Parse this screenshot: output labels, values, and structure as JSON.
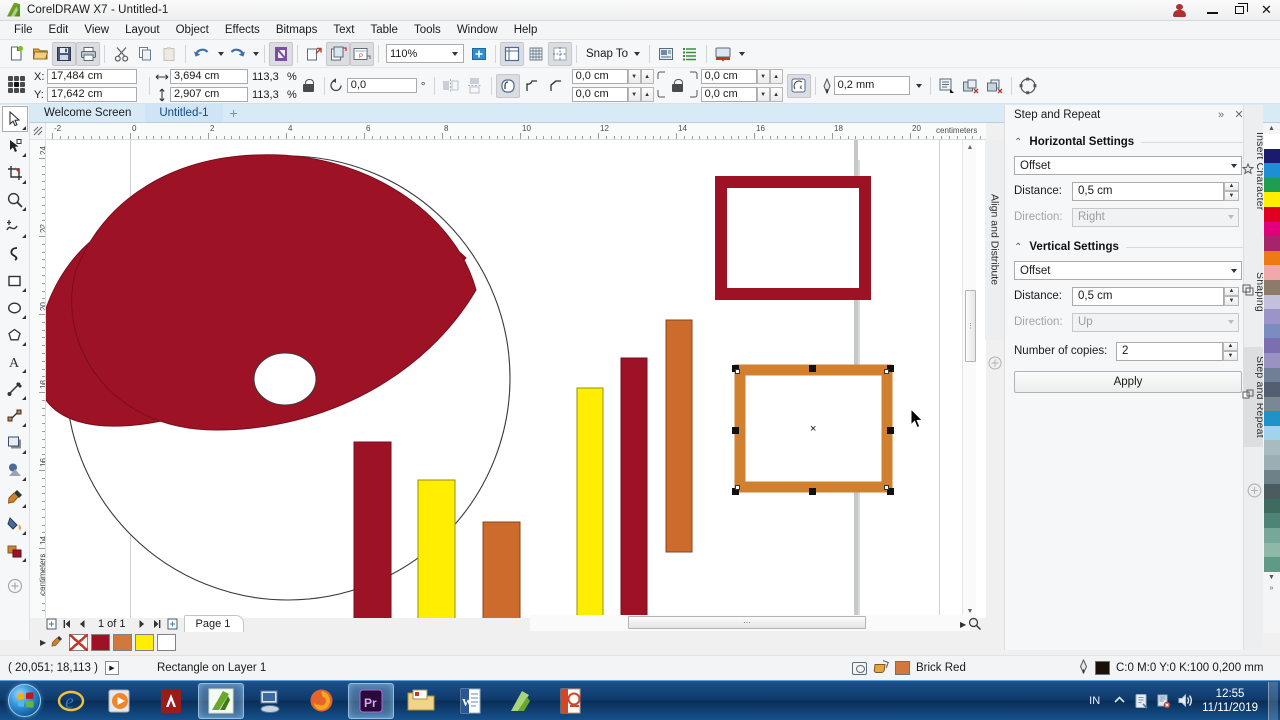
{
  "window": {
    "title": "CorelDRAW X7 - Untitled-1",
    "app_icon": "coreldraw-logo-icon",
    "user_icon": "user-account-icon",
    "minimize": "minimize-button",
    "maximize": "maximize-button",
    "close": "close-button"
  },
  "menubar": {
    "items": [
      {
        "label": "File"
      },
      {
        "label": "Edit"
      },
      {
        "label": "View"
      },
      {
        "label": "Layout"
      },
      {
        "label": "Object"
      },
      {
        "label": "Effects"
      },
      {
        "label": "Bitmaps"
      },
      {
        "label": "Text"
      },
      {
        "label": "Table"
      },
      {
        "label": "Tools"
      },
      {
        "label": "Window"
      },
      {
        "label": "Help"
      }
    ]
  },
  "toolbar": {
    "buttons": [
      {
        "name": "new-document-icon"
      },
      {
        "name": "open-document-icon"
      },
      {
        "name": "save-document-icon"
      },
      {
        "name": "print-icon"
      },
      {
        "name": "cut-icon"
      },
      {
        "name": "copy-icon"
      },
      {
        "name": "paste-icon"
      },
      {
        "name": "undo-icon"
      },
      {
        "name": "redo-icon"
      },
      {
        "name": "import-icon"
      },
      {
        "name": "export-icon"
      },
      {
        "name": "publish-pdf-icon"
      }
    ],
    "zoom_level": "110%",
    "zoom_levels_icon": "zoom-dropdown-icon",
    "fullscreen_icon": "full-screen-preview-icon",
    "snap_to_label": "Snap To",
    "options_icon": "options-icon",
    "object_manager_icon": "object-manager-icon",
    "application_launcher_icon": "application-launcher-icon"
  },
  "property_bar": {
    "x_label": "X:",
    "x_value": "17,484 cm",
    "y_label": "Y:",
    "y_value": "17,642 cm",
    "width_icon": "object-width-icon",
    "width_value": "3,694 cm",
    "height_icon": "object-height-icon",
    "height_value": "2,907 cm",
    "scale_x": "113,3",
    "scale_y": "113,3",
    "percent": "%",
    "lock_ratio_icon": "lock-ratio-icon",
    "rotate_icon": "rotate-angle-icon",
    "rotate_value": "0,0",
    "degrees": "°",
    "mirror_h_icon": "mirror-horizontal-icon",
    "mirror_v_icon": "mirror-vertical-icon",
    "corner_round_icon": "corner-round-icon",
    "corner_scallop_icon": "corner-scallop-icon",
    "corner_chamfer_icon": "corner-chamfer-icon",
    "corner_tl": "0,0 cm",
    "corner_bl": "0,0 cm",
    "corner_tr": "0,0 cm",
    "corner_br": "0,0 cm",
    "corner_lock_icon": "edit-corners-together-icon",
    "relative_corner_icon": "relative-corner-scaling-icon",
    "outline_icon": "outline-width-icon",
    "outline_width": "0,2 mm",
    "text_wrap_icon": "wrap-text-icon",
    "to_front_icon": "to-front-of-page-icon",
    "to_back_icon": "to-back-of-page-icon",
    "convert_to_curves_icon": "convert-to-curves-icon"
  },
  "document_tabs": {
    "tabs": [
      {
        "label": "Welcome Screen",
        "active": false
      },
      {
        "label": "Untitled-1",
        "active": true
      }
    ],
    "add_label": "+"
  },
  "toolbox": {
    "tools": [
      {
        "name": "pick-tool",
        "active": true
      },
      {
        "name": "shape-tool",
        "active": false
      },
      {
        "name": "crop-tool",
        "active": false
      },
      {
        "name": "zoom-tool",
        "active": false
      },
      {
        "name": "freehand-tool",
        "active": false
      },
      {
        "name": "smart-drawing-tool",
        "active": false
      },
      {
        "name": "rectangle-tool",
        "active": false
      },
      {
        "name": "ellipse-tool",
        "active": false
      },
      {
        "name": "polygon-tool",
        "active": false
      },
      {
        "name": "text-tool",
        "active": false
      },
      {
        "name": "dimension-tool",
        "active": false
      },
      {
        "name": "connector-tool",
        "active": false
      },
      {
        "name": "drop-shadow-tool",
        "active": false
      },
      {
        "name": "transparency-tool",
        "active": false
      },
      {
        "name": "color-eyedropper-tool",
        "active": false
      },
      {
        "name": "interactive-fill-tool",
        "active": false
      },
      {
        "name": "smart-fill-tool",
        "active": false
      }
    ],
    "quick_customize_icon": "quick-customize-icon"
  },
  "rulers": {
    "units": "centimeters",
    "h_labels": [
      "-2",
      "0",
      "2",
      "4",
      "6",
      "8",
      "10",
      "12",
      "14",
      "16",
      "18",
      "20"
    ],
    "v_labels": [
      "24",
      "22",
      "20",
      "18",
      "16",
      "14"
    ]
  },
  "canvas": {
    "artwork": {
      "circle_outline": {
        "name": "circle-outline-shape",
        "stroke": "#3a3a3a"
      },
      "petal": {
        "name": "red-lens-shape",
        "fill": "#9e1226"
      },
      "small_ellipse": {
        "name": "small-ellipse-shape",
        "stroke": "#3a3a3a"
      },
      "bars": [
        {
          "name": "bar-1",
          "color": "#9e1226"
        },
        {
          "name": "bar-2",
          "color": "#ffee00"
        },
        {
          "name": "bar-3",
          "color": "#cc6b2b"
        },
        {
          "name": "bar-4",
          "color": "#ffee00"
        },
        {
          "name": "bar-5",
          "color": "#9e1226"
        },
        {
          "name": "bar-6",
          "color": "#cc6b2b"
        }
      ],
      "rect_top": {
        "name": "brick-red-rectangle",
        "stroke": "#9e1226"
      },
      "rect_selected": {
        "name": "orange-rectangle-selected",
        "stroke": "#d18030"
      }
    },
    "selection": {
      "handles": 8,
      "center_marker": "×"
    }
  },
  "page_nav": {
    "add_page_before_icon": "add-page-before-icon",
    "first_icon": "first-page-icon",
    "prev_icon": "previous-page-icon",
    "counter": "1 of 1",
    "next_icon": "next-page-icon",
    "last_icon": "last-page-icon",
    "add_page_after_icon": "add-page-after-icon",
    "page_tab": "Page 1"
  },
  "color_well": {
    "swatches": [
      {
        "name": "no-color-swatch",
        "color": "none"
      },
      {
        "name": "dark-red-swatch",
        "color": "#9e1226"
      },
      {
        "name": "brick-red-swatch",
        "color": "#d1793c"
      },
      {
        "name": "yellow-swatch",
        "color": "#ffee00"
      },
      {
        "name": "white-swatch",
        "color": "#ffffff"
      }
    ]
  },
  "status_bar": {
    "coordinates": "( 20,051; 18,113 )",
    "cursor_icon": "pointer-icon",
    "object_info": "Rectangle on Layer 1",
    "monitor_icon": "color-proof-icon",
    "fill_icon": "fill-color-icon",
    "fill_color": "#d1793c",
    "fill_label": "Brick Red",
    "outline_icon": "outline-pen-icon",
    "outline_color": "#1a1209",
    "outline_label": "C:0 M:0 Y:0 K:100  0,200 mm"
  },
  "docker": {
    "title": "Step and Repeat",
    "collapse_icon": "collapse-docker-icon",
    "close_icon": "close-docker-icon",
    "horizontal": {
      "group_label": "Horizontal Settings",
      "mode": "Offset",
      "distance_label": "Distance:",
      "distance_value": "0,5 cm",
      "direction_label": "Direction:",
      "direction_value": "Right"
    },
    "vertical": {
      "group_label": "Vertical Settings",
      "mode": "Offset",
      "distance_label": "Distance:",
      "distance_value": "0,5 cm",
      "direction_label": "Direction:",
      "direction_value": "Up"
    },
    "copies_label": "Number of copies:",
    "copies_value": "2",
    "apply_label": "Apply"
  },
  "docker_tabs": {
    "left_tab": "Align and Distribute",
    "tabs": [
      {
        "label": "Insert Character",
        "icon": "insert-character-icon",
        "selected": false
      },
      {
        "label": "Shaping",
        "icon": "shaping-icon",
        "selected": false
      },
      {
        "label": "Step and Repeat",
        "icon": "step-and-repeat-icon",
        "selected": true
      }
    ],
    "add_docker_icon": "add-docker-icon"
  },
  "palette": {
    "scroll_up_icon": "palette-scroll-up-icon",
    "scroll_down_icon": "palette-scroll-down-icon",
    "expand_icon": "palette-expand-icon",
    "colors": [
      "#ffffff",
      "#1b1b6e",
      "#1f8fd4",
      "#1f9e4f",
      "#ffee00",
      "#e00020",
      "#e0007a",
      "#a8246a",
      "#ed7a12",
      "#f0a8a8",
      "#8c7a6b",
      "#c4c0dc",
      "#9a94c8",
      "#7a8cc0",
      "#7b6fb0",
      "#9a92c0",
      "#6f7f96",
      "#545e70",
      "#7a8894",
      "#1f93c9",
      "#9fd4ec",
      "#a8bcc0",
      "#9aaeb4",
      "#6e8088",
      "#4a5c60",
      "#3f6a60",
      "#4e8476",
      "#76a89a",
      "#8fb8a8",
      "#5f9a86"
    ]
  },
  "taskbar": {
    "start_label": "start-orb",
    "items": [
      {
        "name": "internet-explorer-icon",
        "running": false
      },
      {
        "name": "windows-media-player-icon",
        "running": false
      },
      {
        "name": "adobe-acrobat-icon",
        "running": false
      },
      {
        "name": "coreldraw-icon",
        "running": true
      },
      {
        "name": "scanner-icon",
        "running": false
      },
      {
        "name": "firefox-icon",
        "running": false
      },
      {
        "name": "adobe-premiere-icon",
        "running": true
      },
      {
        "name": "folder-icon",
        "running": false
      },
      {
        "name": "microsoft-word-icon",
        "running": false
      },
      {
        "name": "corel-photo-paint-icon",
        "running": false
      },
      {
        "name": "powerpoint-icon",
        "running": false
      }
    ],
    "tray": {
      "language": "IN",
      "show_hidden_icon": "show-hidden-icons-icon",
      "action_center_icon": "action-center-icon",
      "network_icon": "network-icon",
      "volume_icon": "volume-icon",
      "time": "12:55",
      "date": "11/11/2019"
    }
  }
}
